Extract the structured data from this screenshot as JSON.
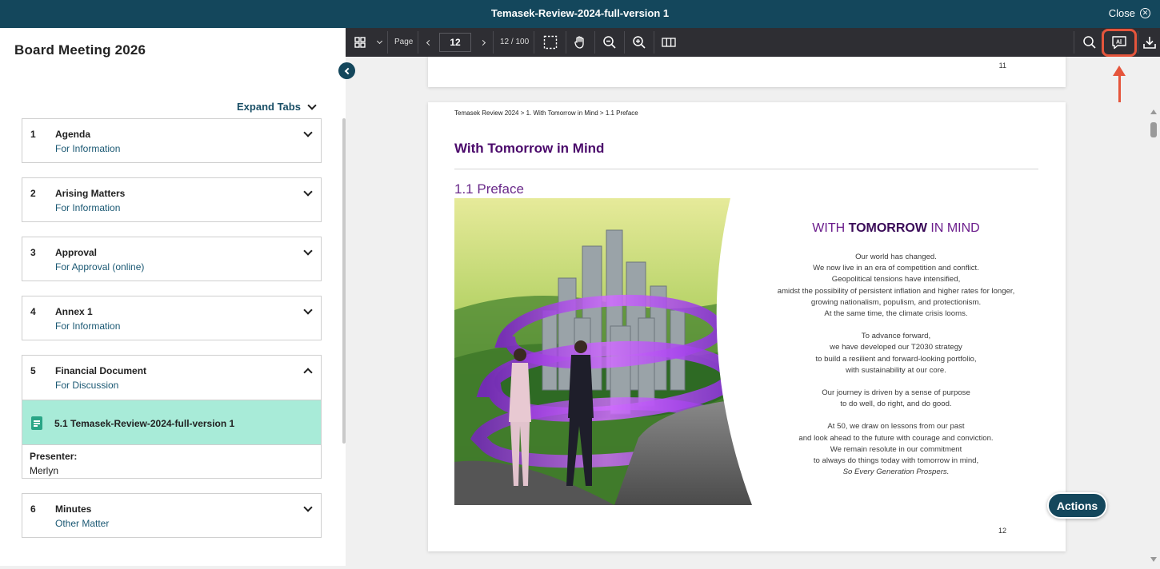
{
  "window": {
    "title": "Temasek-Review-2024-full-version 1",
    "close_label": "Close"
  },
  "sidebar": {
    "meeting_title": "Board Meeting 2026",
    "expand_tabs_label": "Expand Tabs",
    "items": [
      {
        "number": "1",
        "name": "Agenda",
        "type": "For Information"
      },
      {
        "number": "2",
        "name": "Arising Matters",
        "type": "For Information"
      },
      {
        "number": "3",
        "name": "Approval",
        "type": "For Approval (online)"
      },
      {
        "number": "4",
        "name": "Annex 1",
        "type": "For Information"
      },
      {
        "number": "5",
        "name": "Financial Document",
        "type": "For Discussion",
        "subitem": "5.1 Temasek-Review-2024-full-version 1",
        "presenter_label": "Presenter:",
        "presenter": "Merlyn"
      },
      {
        "number": "6",
        "name": "Minutes",
        "type": "Other Matter"
      }
    ]
  },
  "toolbar": {
    "page_label": "Page",
    "current_page": "12",
    "page_total": "12 / 100"
  },
  "document": {
    "prev_page_number": "11",
    "breadcrumb": "Temasek Review 2024 > 1. With Tomorrow in Mind > 1.1 Preface",
    "heading": "With Tomorrow in Mind",
    "subheading": "1.1 Preface",
    "poem_title_pre": "WITH ",
    "poem_title_bold": "TOMORROW",
    "poem_title_post": " IN MIND",
    "stanza1": [
      "Our world has changed.",
      "We now live in an era of competition and conflict.",
      "Geopolitical tensions have intensified,",
      "amidst the possibility of persistent inflation and higher rates for longer,",
      "growing nationalism, populism, and protectionism.",
      "At the same time, the climate crisis looms."
    ],
    "stanza2": [
      "To advance forward,",
      "we have developed our T2030 strategy",
      "to build a resilient and forward-looking portfolio,",
      "with sustainability at our core."
    ],
    "stanza3": [
      "Our journey is driven by a sense of purpose",
      "to do well, do right, and do good."
    ],
    "stanza4": [
      "At 50, we draw on lessons from our past",
      "and look ahead to the future with courage and conviction.",
      "We remain resolute in our commitment",
      "to always do things today with tomorrow in mind,"
    ],
    "stanza4_italic": "So Every Generation Prospers.",
    "page_number": "12"
  },
  "actions_label": "Actions",
  "colors": {
    "header": "#14475c",
    "toolbar": "#2e2e33",
    "selected_item": "#a8ebd8",
    "highlight": "#e5553c",
    "heading_purple": "#4b0a6b"
  }
}
